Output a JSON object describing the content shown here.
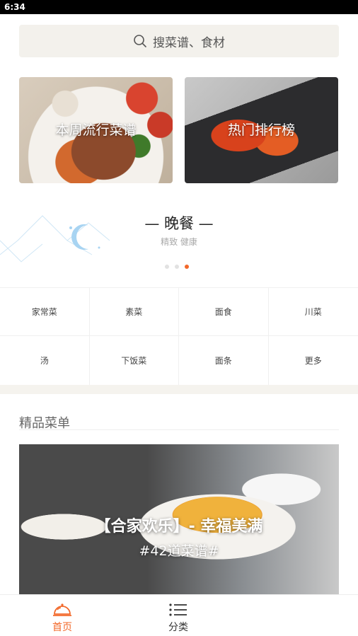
{
  "status_bar": {
    "time": "6:34"
  },
  "search": {
    "placeholder": "搜菜谱、食材",
    "icon": "search-icon"
  },
  "banners": [
    {
      "title": "本周流行菜谱"
    },
    {
      "title": "热门排行榜"
    }
  ],
  "meal": {
    "heading": "— 晚餐 —",
    "subtitle": "精致 健康",
    "icon": "moon-icon",
    "dots_total": 3,
    "dots_active_index": 2
  },
  "categories": [
    "家常菜",
    "素菜",
    "面食",
    "川菜",
    "汤",
    "下饭菜",
    "面条",
    "更多"
  ],
  "section": {
    "title": "精品菜单"
  },
  "feature": {
    "title": "【合家欢乐】- 幸福美满",
    "subtitle": "#42道菜谱#"
  },
  "tabbar": {
    "items": [
      {
        "label": "首页",
        "icon": "cloche-icon",
        "active": true
      },
      {
        "label": "分类",
        "icon": "list-icon",
        "active": false
      }
    ],
    "active_color": "#f2682a"
  }
}
